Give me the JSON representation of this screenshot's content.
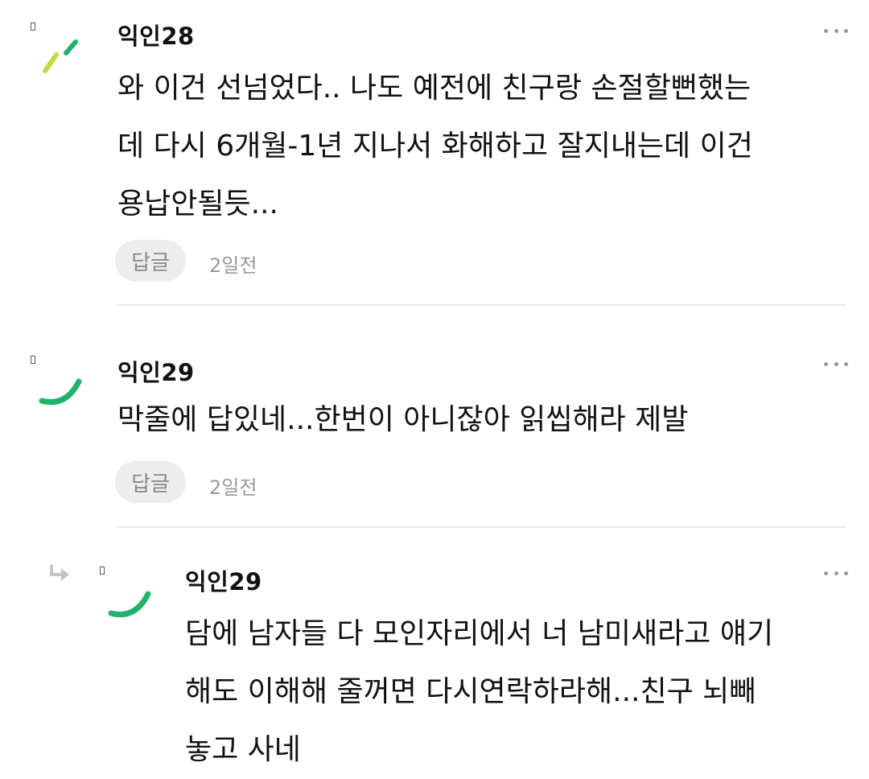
{
  "comments": [
    {
      "author": "익인28",
      "body": "와 이건 선넘었다.. 나도 예전에 친구랑 손절할뻔했는\n데 다시 6개월-1년 지나서 화해하고 잘지내는데 이건\n용납안될듯...",
      "reply_label": "답글",
      "time": "2일전",
      "avatar_icon": "slash-lines-avatar-icon",
      "avatar_colors": [
        "#c9d83a",
        "#21b36b"
      ]
    },
    {
      "author": "익인29",
      "body": "막줄에 답있네...한번이 아니잖아 읽씹해라 제발",
      "reply_label": "답글",
      "time": "2일전",
      "avatar_icon": "arc-avatar-icon",
      "avatar_colors": [
        "#21b36b"
      ]
    },
    {
      "author": "익인29",
      "body": "담에 남자들 다 모인자리에서 너 남미새라고 얘기\n해도 이해해 줄꺼면 다시연락하라해...친구 뇌빼\n놓고 사네",
      "avatar_icon": "arc-avatar-icon",
      "avatar_colors": [
        "#21b36b"
      ],
      "is_reply": true
    }
  ],
  "icons": {
    "more": "more-options-icon",
    "reply_arrow": "reply-arrow-icon"
  }
}
